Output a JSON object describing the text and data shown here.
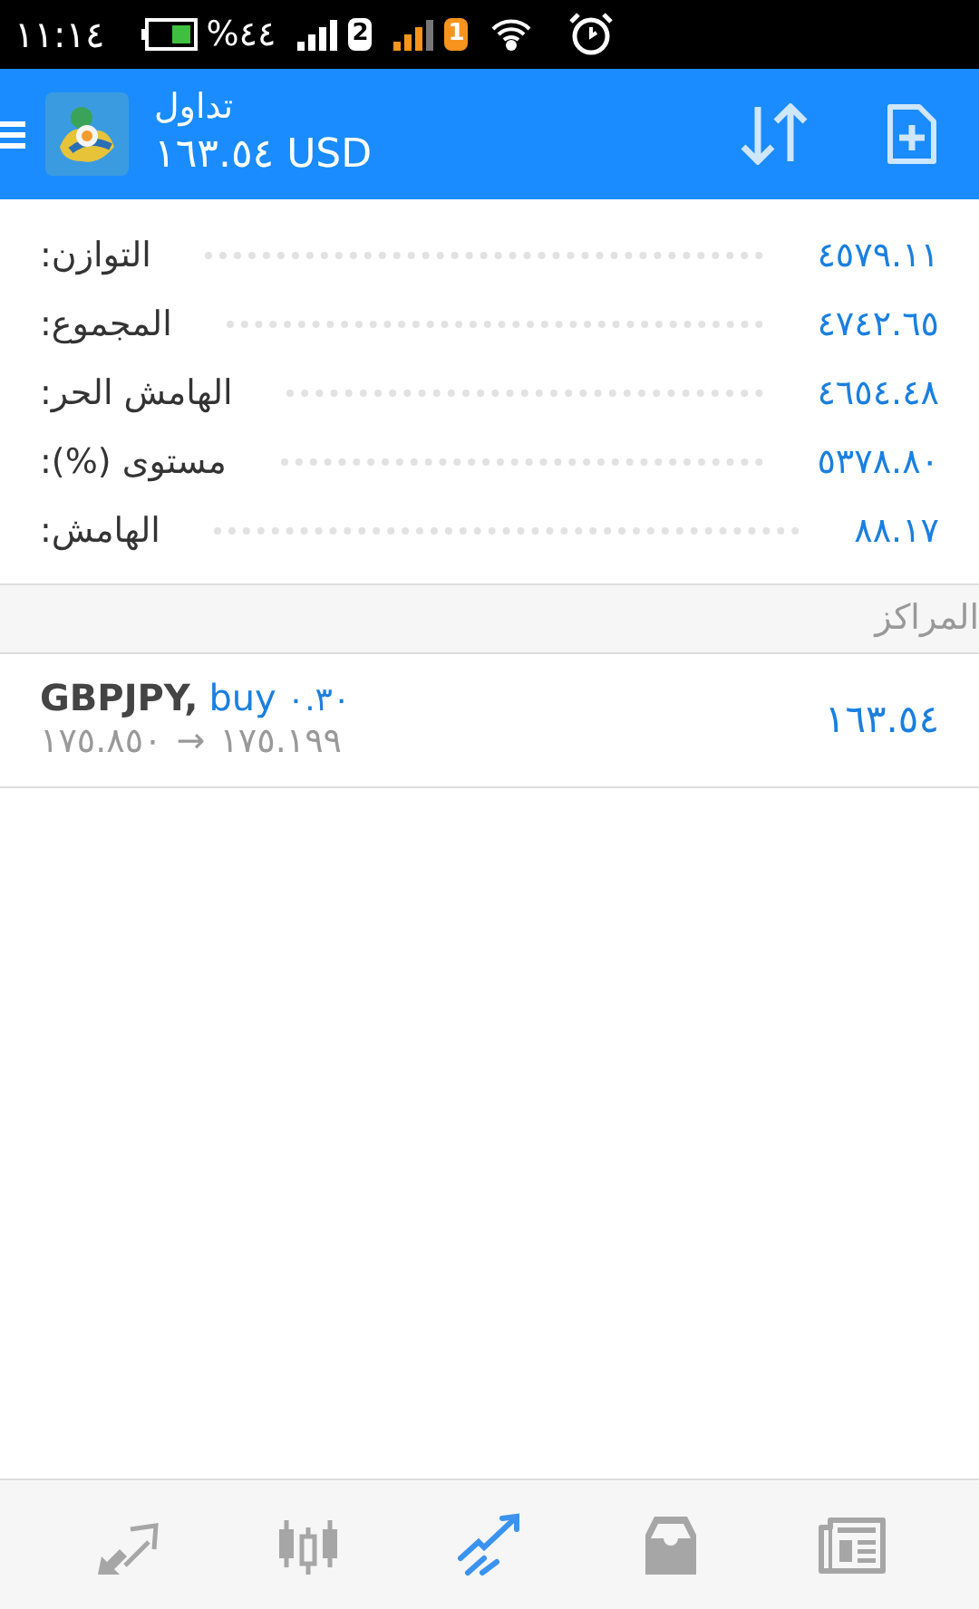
{
  "status_bar": {
    "time": "١١:١٤",
    "battery_percent": "%٤٤",
    "sim_slot_a": {
      "badge": "2"
    },
    "sim_slot_b": {
      "badge": "1"
    }
  },
  "header": {
    "title": "تداول",
    "subtitle": "١٦٣.٥٤ USD"
  },
  "summary": [
    {
      "label": "التوازن:",
      "value": "٤٥٧٩.١١"
    },
    {
      "label": "المجموع:",
      "value": "٤٧٤٢.٦٥"
    },
    {
      "label": "الهامش الحر:",
      "value": "٤٦٥٤.٤٨"
    },
    {
      "label": "مستوى (%):",
      "value": "٥٣٧٨.٨٠"
    },
    {
      "label": "الهامش:",
      "value": "٨٨.١٧"
    }
  ],
  "positions": {
    "title": "المراكز",
    "items": [
      {
        "symbol": "GBPJPY,",
        "side": "buy",
        "volume": "٠.٣٠",
        "open_price": "١٧٥.٨٥٠",
        "arrow": "→",
        "current_price": "١٧٥.١٩٩",
        "profit": "١٦٣.٥٤"
      }
    ]
  },
  "bottom_nav": [
    {
      "kind": "trade",
      "selected": false
    },
    {
      "kind": "chart",
      "selected": false
    },
    {
      "kind": "trading",
      "selected": true
    },
    {
      "kind": "history",
      "selected": false
    },
    {
      "kind": "news",
      "selected": false
    }
  ]
}
